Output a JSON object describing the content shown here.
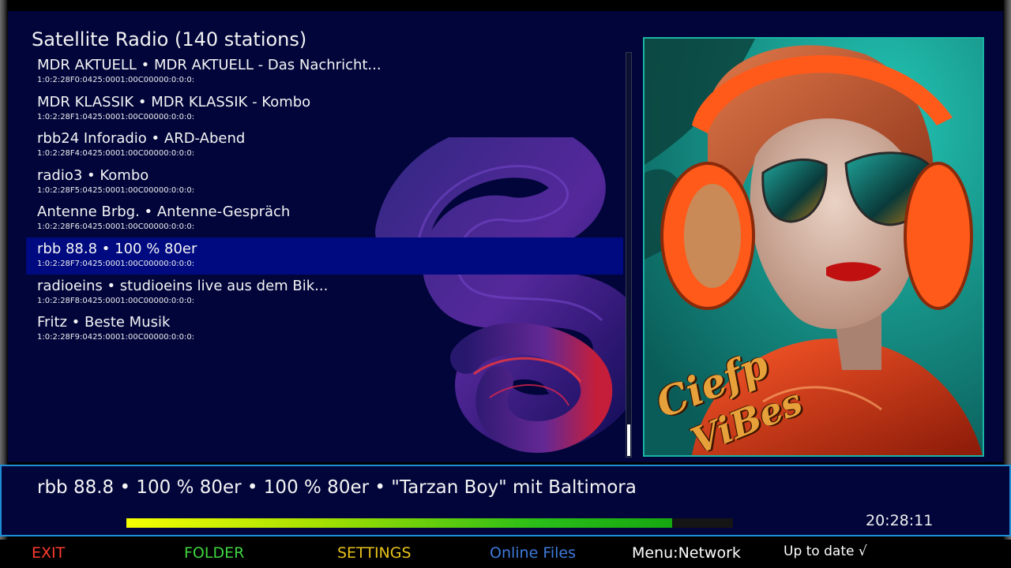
{
  "list": {
    "title": "Satellite Radio (140 stations)",
    "selected_index": 5,
    "items": [
      {
        "name": "MDR AKTUELL • MDR AKTUELL - Das Nachricht...",
        "ref": "1:0:2:28F0:0425:0001:00C00000:0:0:0:"
      },
      {
        "name": "MDR KLASSIK • MDR KLASSIK - Kombo",
        "ref": "1:0:2:28F1:0425:0001:00C00000:0:0:0:"
      },
      {
        "name": "rbb24 Inforadio • ARD-Abend",
        "ref": "1:0:2:28F4:0425:0001:00C00000:0:0:0:"
      },
      {
        "name": "radio3 • Kombo",
        "ref": "1:0:2:28F5:0425:0001:00C00000:0:0:0:"
      },
      {
        "name": "Antenne Brbg. • Antenne-Gespräch",
        "ref": "1:0:2:28F6:0425:0001:00C00000:0:0:0:"
      },
      {
        "name": "rbb 88.8 • 100 % 80er",
        "ref": "1:0:2:28F7:0425:0001:00C00000:0:0:0:"
      },
      {
        "name": "radioeins • studioeins live aus dem Bik...",
        "ref": "1:0:2:28F8:0425:0001:00C00000:0:0:0:"
      },
      {
        "name": "Fritz • Beste Musik",
        "ref": "1:0:2:28F9:0425:0001:00C00000:0:0:0:"
      }
    ]
  },
  "cover": {
    "text_line1": "Ciefp",
    "text_line2": "ViBes"
  },
  "info": {
    "now_playing": "rbb 88.8 • 100 % 80er • 100 % 80er • \"Tarzan Boy\" mit Baltimora",
    "progress": 0.9,
    "clock": "20:28:11"
  },
  "footer": {
    "exit_label": "EXIT",
    "folder_label": "FOLDER",
    "settings_label": "SETTINGS",
    "online_label": "Online Files",
    "menu_label": "Menu:Network",
    "status_label": "Up to date  √"
  },
  "colors": {
    "background": "#01053a",
    "selection": "#000a80",
    "info_border": "#1e8fd6",
    "exit": "#ff3b2f",
    "folder": "#3fd63f",
    "settings": "#e8c21c",
    "online": "#3f7bdc"
  }
}
